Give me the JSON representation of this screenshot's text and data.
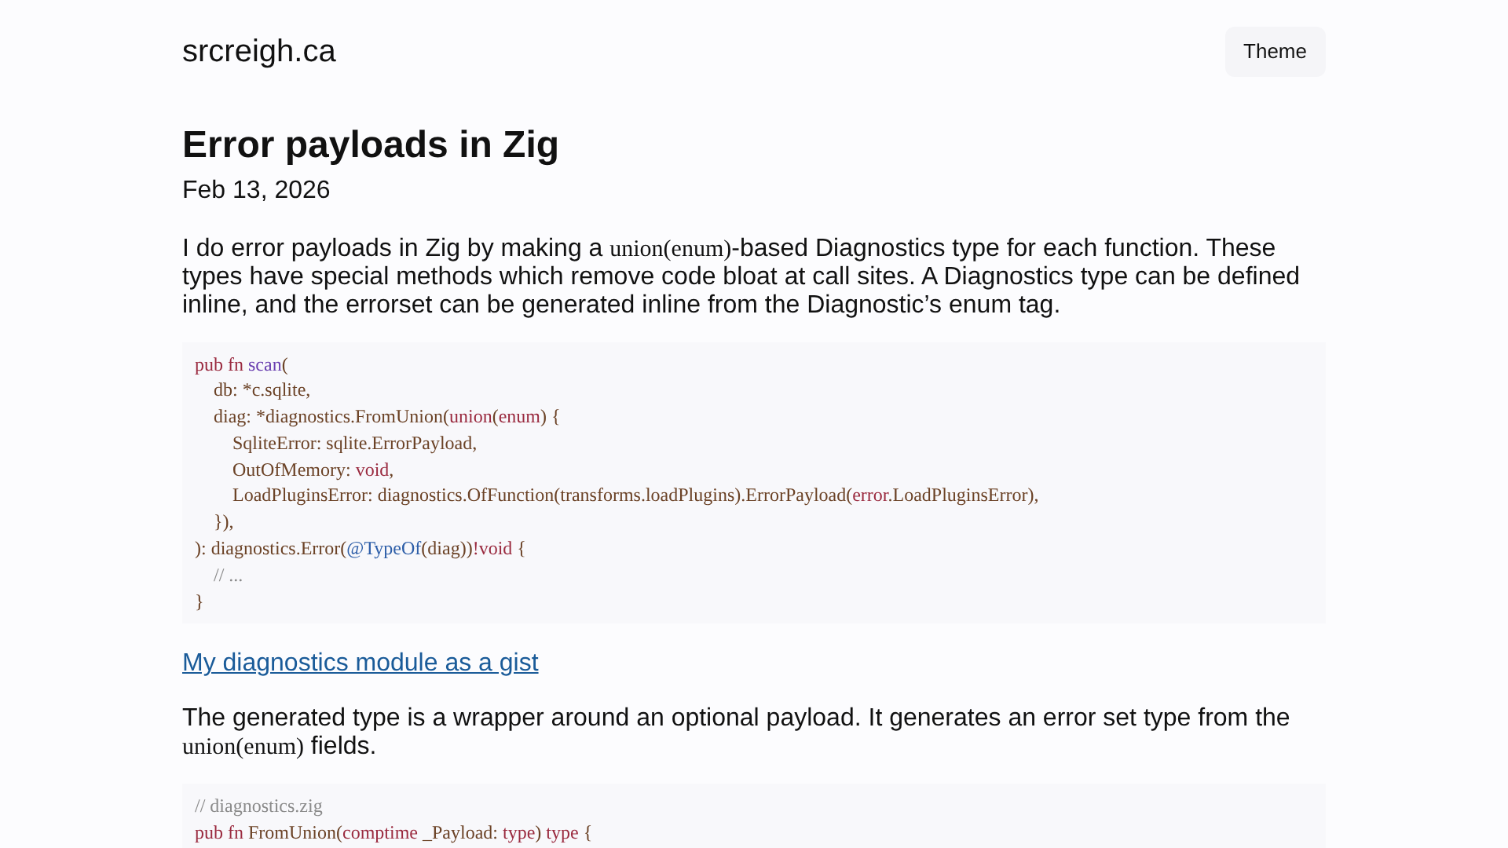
{
  "site": {
    "name": "srcreigh.ca",
    "theme_button": "Theme"
  },
  "article": {
    "title": "Error payloads in Zig",
    "date": "Feb 13, 2026",
    "blocks": [
      {
        "kind": "paragraph",
        "parts": [
          {
            "kind": "text",
            "text": "I do error payloads in Zig by making a "
          },
          {
            "kind": "code",
            "text": "union(enum)"
          },
          {
            "kind": "text",
            "text": "-based Diagnostics type for each function. These types have special methods which remove code bloat at call sites. A Diagnostics type can be defined inline, and the errorset can be generated inline from the Diagnostic’s enum tag."
          }
        ]
      },
      {
        "kind": "codeblock",
        "lines": [
          {
            "tokens": [
              {
                "kind": "keyword",
                "text": "pub fn"
              },
              {
                "kind": "name",
                "text": " scan"
              },
              {
                "kind": "plain",
                "text": "("
              }
            ],
            "children": [
              {
                "tokens": [
                  {
                    "kind": "plain",
                    "text": "db: *c.sqlite,"
                  }
                ]
              },
              {
                "tokens": [
                  {
                    "kind": "plain",
                    "text": "diag: *diagnostics.FromUnion("
                  },
                  {
                    "kind": "keyword",
                    "text": "union"
                  },
                  {
                    "kind": "plain",
                    "text": "("
                  },
                  {
                    "kind": "keyword",
                    "text": "enum"
                  },
                  {
                    "kind": "plain",
                    "text": ") {"
                  }
                ],
                "children": [
                  {
                    "tokens": [
                      {
                        "kind": "plain",
                        "text": "SqliteError: sqlite.ErrorPayload,"
                      }
                    ]
                  },
                  {
                    "tokens": [
                      {
                        "kind": "plain",
                        "text": "OutOfMemory: "
                      },
                      {
                        "kind": "keyword",
                        "text": "void"
                      },
                      {
                        "kind": "plain",
                        "text": ","
                      }
                    ]
                  },
                  {
                    "tokens": [
                      {
                        "kind": "plain",
                        "text": "LoadPluginsError: diagnostics.OfFunction(transforms.loadPlugins).ErrorPayload("
                      },
                      {
                        "kind": "keyword",
                        "text": "error"
                      },
                      {
                        "kind": "plain",
                        "text": ".LoadPluginsError),"
                      }
                    ]
                  }
                ]
              },
              {
                "tokens": [
                  {
                    "kind": "plain",
                    "text": "}),"
                  }
                ]
              }
            ]
          },
          {
            "tokens": [
              {
                "kind": "plain",
                "text": "): diagnostics.Error("
              },
              {
                "kind": "builtin",
                "text": "@TypeOf"
              },
              {
                "kind": "plain",
                "text": "(diag))"
              },
              {
                "kind": "keyword",
                "text": "!void"
              },
              {
                "kind": "plain",
                "text": " {"
              }
            ],
            "children": [
              {
                "tokens": [
                  {
                    "kind": "comment",
                    "text": "// ..."
                  }
                ]
              }
            ]
          },
          {
            "tokens": [
              {
                "kind": "plain",
                "text": "}"
              }
            ]
          }
        ]
      },
      {
        "kind": "link",
        "text": "My diagnostics module as a gist"
      },
      {
        "kind": "paragraph",
        "parts": [
          {
            "kind": "text",
            "text": "The generated type is a wrapper around an optional payload. It generates an error set type from the "
          },
          {
            "kind": "code",
            "text": "union(enum)"
          },
          {
            "kind": "text",
            "text": " fields."
          }
        ]
      },
      {
        "kind": "codeblock",
        "lines": [
          {
            "tokens": [
              {
                "kind": "comment",
                "text": "// diagnostics.zig"
              }
            ]
          },
          {
            "tokens": [
              {
                "kind": "keyword",
                "text": "pub fn"
              },
              {
                "kind": "plain",
                "text": " FromUnion("
              },
              {
                "kind": "keyword",
                "text": "comptime"
              },
              {
                "kind": "plain",
                "text": " _Payload: "
              },
              {
                "kind": "keyword",
                "text": "type"
              },
              {
                "kind": "plain",
                "text": ") "
              },
              {
                "kind": "keyword",
                "text": "type"
              },
              {
                "kind": "plain",
                "text": " {"
              }
            ]
          }
        ]
      }
    ]
  }
}
